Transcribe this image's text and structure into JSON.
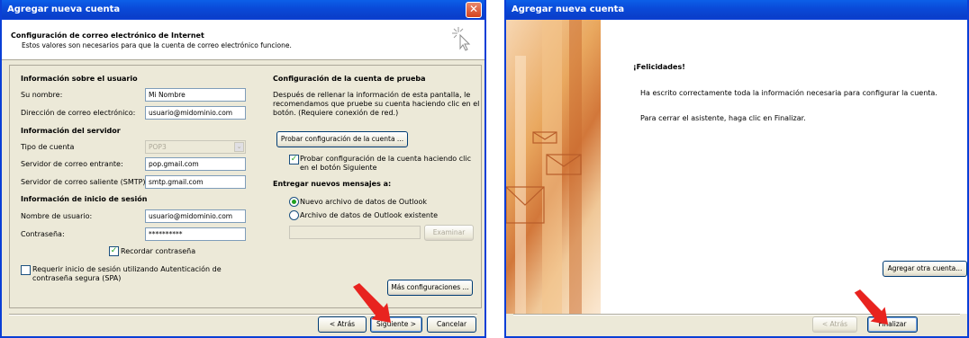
{
  "window1": {
    "title": "Agregar nueva cuenta",
    "close_glyph": "✕",
    "header": {
      "title": "Configuración de correo electrónico de Internet",
      "subtitle": "Estos valores son necesarios para que la cuenta de correo electrónico funcione."
    },
    "user_info": {
      "heading": "Información sobre el usuario",
      "name_label": "Su nombre:",
      "name_value": "Mi Nombre",
      "email_label": "Dirección de correo electrónico:",
      "email_value": "usuario@midominio.com"
    },
    "server_info": {
      "heading": "Información del servidor",
      "type_label": "Tipo de cuenta",
      "type_value": "POP3",
      "incoming_label": "Servidor de correo entrante:",
      "incoming_value": "pop.gmail.com",
      "outgoing_label": "Servidor de correo saliente (SMTP):",
      "outgoing_value": "smtp.gmail.com"
    },
    "login_info": {
      "heading": "Información de inicio de sesión",
      "user_label": "Nombre de usuario:",
      "user_value": "usuario@midominio.com",
      "password_label": "Contraseña:",
      "password_value": "**********",
      "remember_label": "Recordar contraseña",
      "spa_line1": "Requerir inicio de sesión utilizando Autenticación de",
      "spa_line2": "contraseña segura (SPA)"
    },
    "test": {
      "heading": "Configuración de la cuenta de prueba",
      "desc_line1": "Después de rellenar la información de esta pantalla, le",
      "desc_line2": "recomendamos que pruebe su cuenta haciendo clic en el",
      "desc_line3": "botón. (Requiere conexión de red.)",
      "test_button": "Probar configuración de la cuenta ...",
      "auto_test_line1": "Probar configuración de la cuenta haciendo clic",
      "auto_test_line2": "en el botón Siguiente"
    },
    "deliver": {
      "heading": "Entregar nuevos mensajes a:",
      "option_new": "Nuevo archivo de datos de Outlook",
      "option_existing": "Archivo de datos de Outlook existente",
      "browse_button": "Examinar"
    },
    "more_settings_button": "Más configuraciones ...",
    "footer": {
      "back": "< Atrás",
      "next": "Siguiente >",
      "cancel": "Cancelar"
    }
  },
  "window2": {
    "title": "Agregar nueva cuenta",
    "congrats": "¡Felicidades!",
    "message1": "Ha escrito correctamente toda la información necesaria para configurar la cuenta.",
    "message2": "Para cerrar el asistente, haga clic en Finalizar.",
    "add_another_button": "Agregar otra cuenta...",
    "footer": {
      "back": "< Atrás",
      "finish": "Finalizar"
    }
  },
  "colors": {
    "titlebar": "#0a49d8",
    "arrow": "#e8231f"
  }
}
